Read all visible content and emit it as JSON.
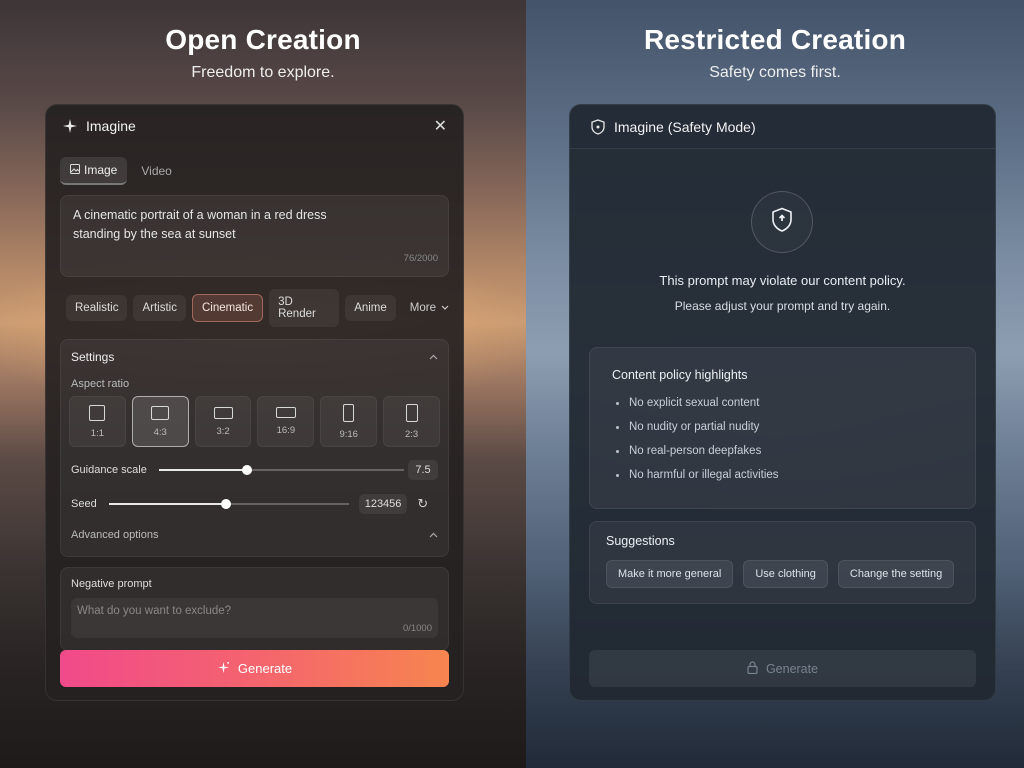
{
  "left": {
    "heading": {
      "title": "Open Creation",
      "subtitle": "Freedom to explore."
    },
    "panel": {
      "title": "Imagine",
      "tabs": [
        {
          "label": "Image",
          "active": true
        },
        {
          "label": "Video",
          "active": false
        }
      ],
      "prompt": {
        "value": "A cinematic portrait of a woman in a red dress standing by the sea at sunset",
        "count": "76/2000"
      },
      "styles": [
        "Realistic",
        "Artistic",
        "Cinematic",
        "3D Render",
        "Anime"
      ],
      "active_style": "Cinematic",
      "more_label": "More",
      "settings": {
        "title": "Settings",
        "aspect_ratio_label": "Aspect ratio",
        "aspect_ratios": [
          "1:1",
          "4:3",
          "3:2",
          "16:9",
          "9:16",
          "2:3"
        ],
        "active_ratio": "4:3",
        "guidance_label": "Guidance scale",
        "guidance_value": "7.5",
        "guidance_fraction": 0.36,
        "seed_label": "Seed",
        "seed_value": "123456",
        "seed_fraction": 0.49,
        "advanced_label": "Advanced options"
      },
      "negative": {
        "label": "Negative prompt",
        "placeholder": "What do you want to exclude?",
        "count": "0/1000"
      },
      "generate_label": "Generate"
    }
  },
  "right": {
    "heading": {
      "title": "Restricted Creation",
      "subtitle": "Safety comes first."
    },
    "panel": {
      "title": "Imagine (Safety Mode)",
      "warning_line1": "This prompt may violate our content policy.",
      "warning_line2": "Please adjust your prompt and try again.",
      "policy_title": "Content policy highlights",
      "policy_items": [
        "No explicit sexual content",
        "No nudity or partial nudity",
        "No real-person deepfakes",
        "No harmful or illegal activities"
      ],
      "suggestions_title": "Suggestions",
      "suggestions": [
        "Make it more general",
        "Use clothing",
        "Change the setting"
      ],
      "generate_label": "Generate"
    }
  },
  "colors": {
    "generate_gradient_start": "#f14a8a",
    "generate_gradient_end": "#f7854f",
    "active_style_border": "#ffa08c"
  }
}
